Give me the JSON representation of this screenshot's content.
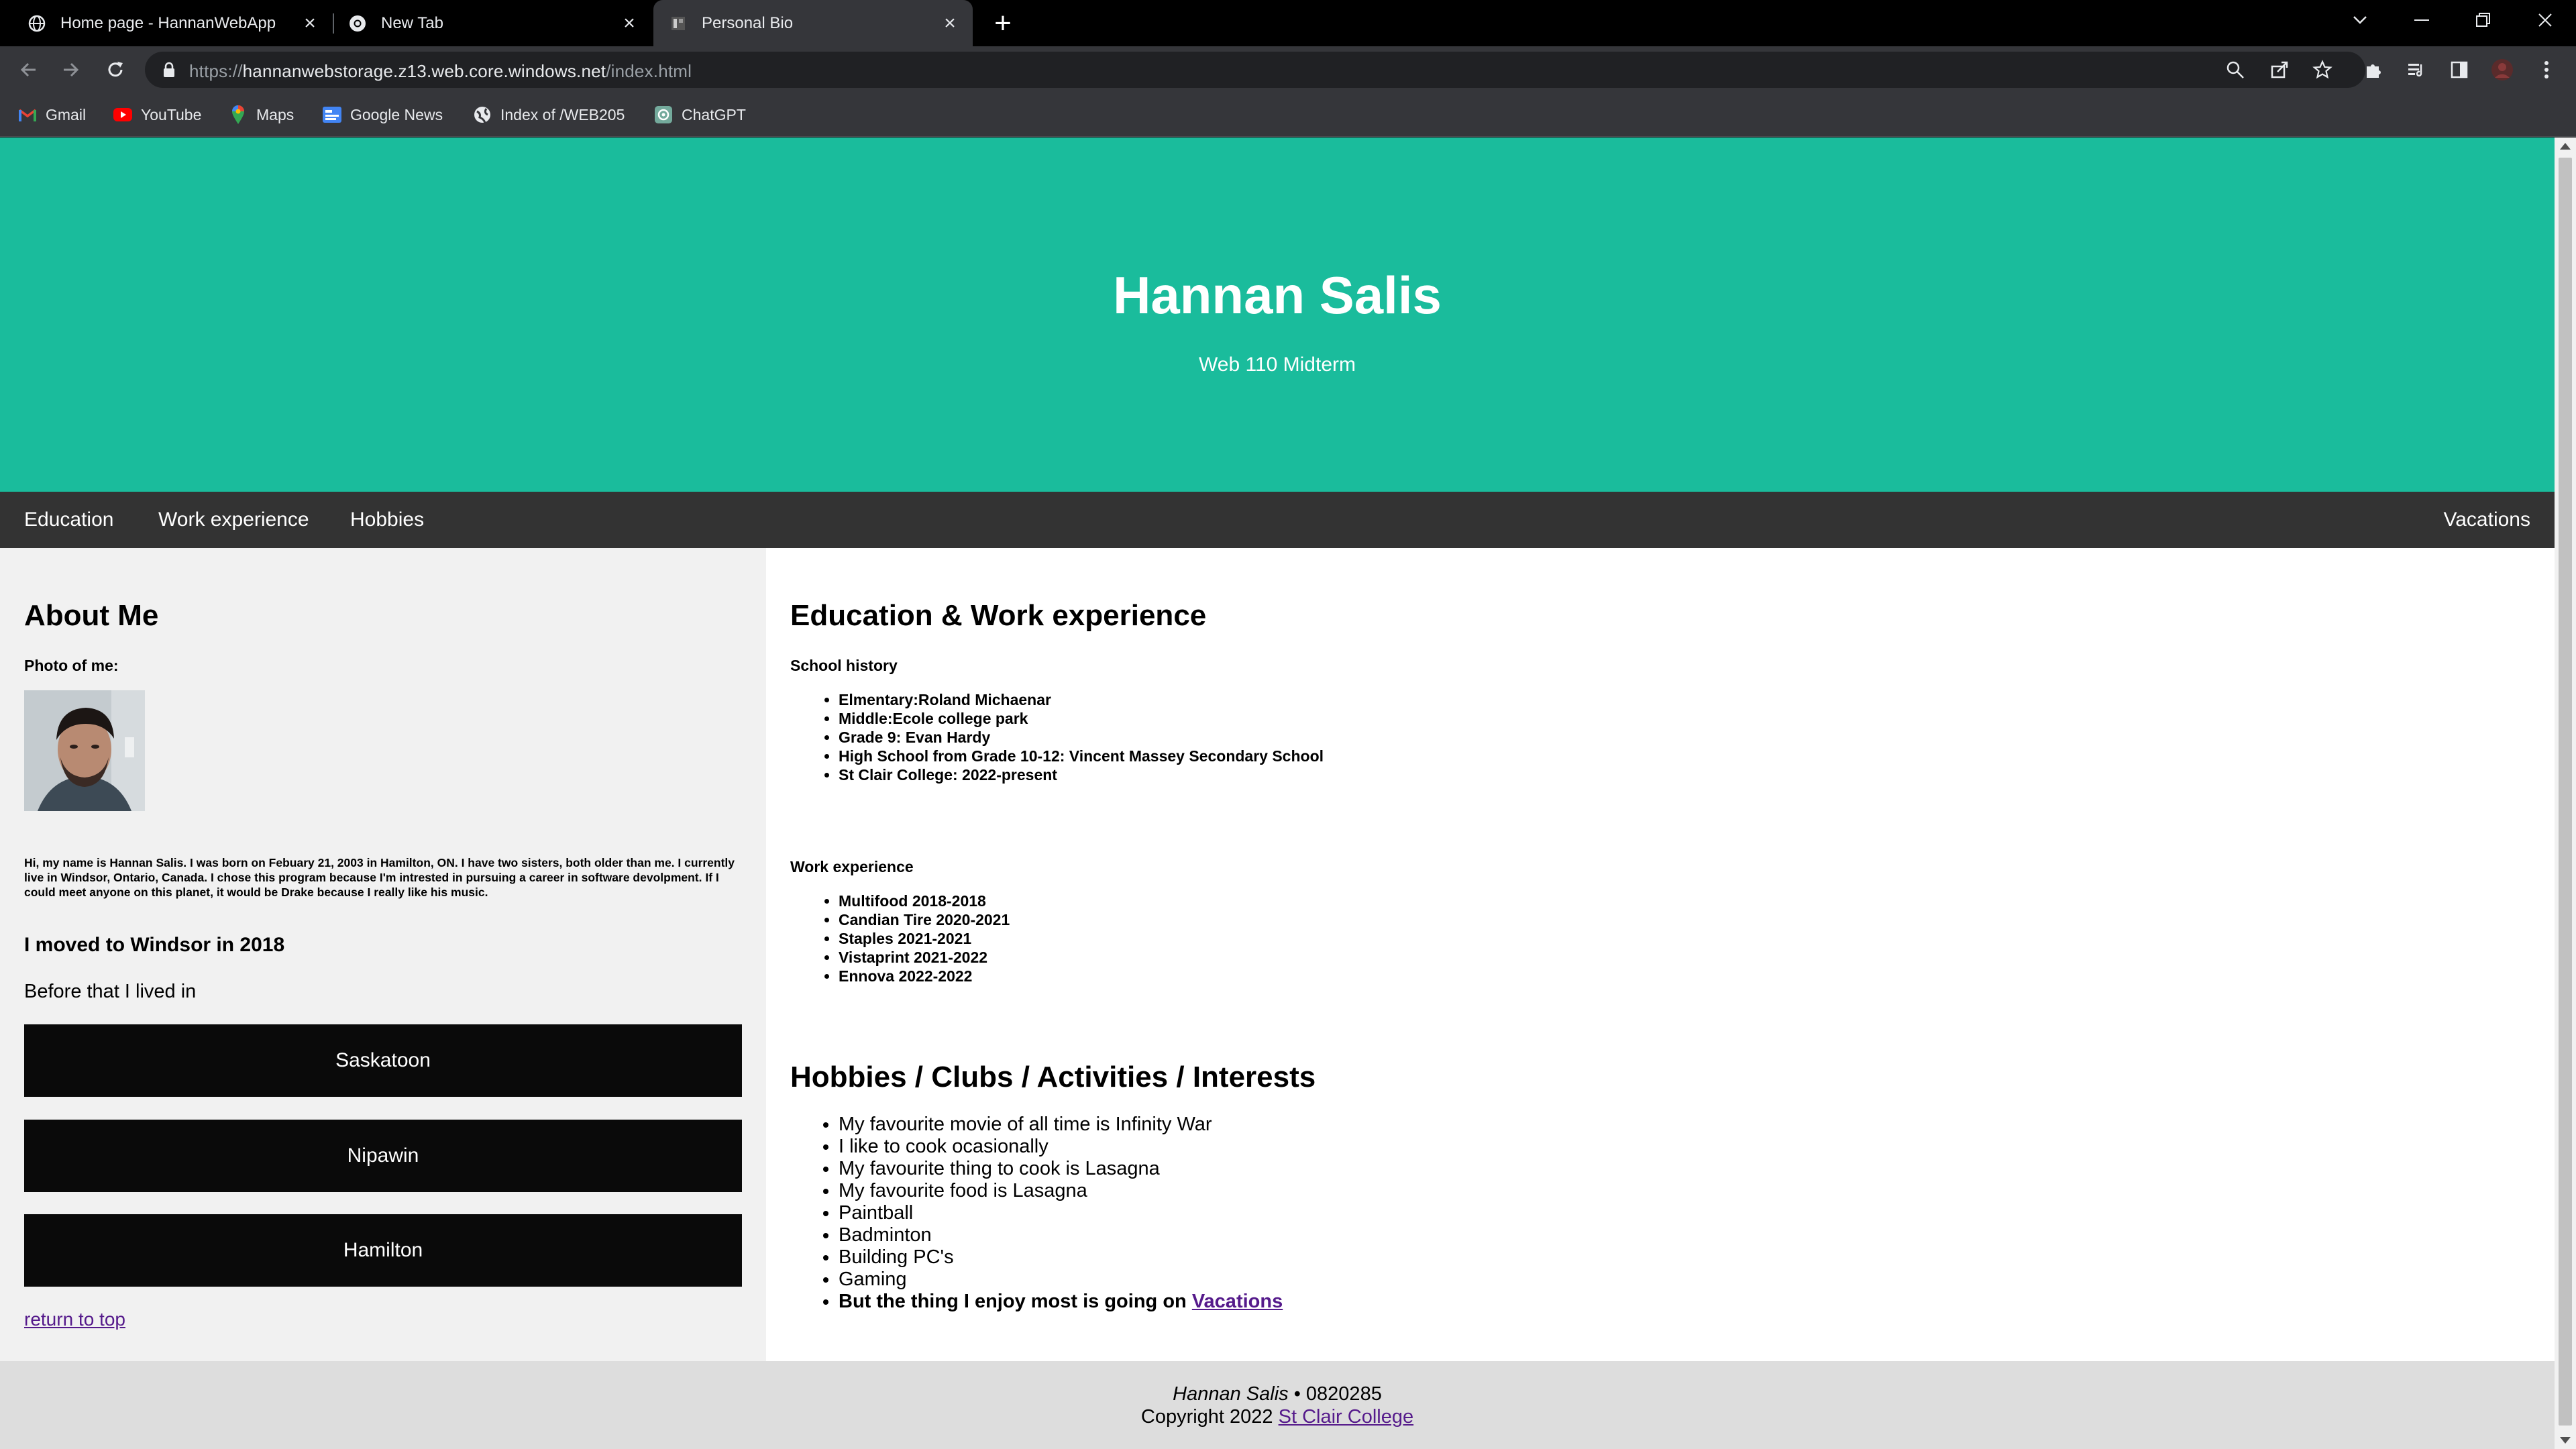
{
  "browser": {
    "tabs": [
      {
        "title": "Home page - HannanWebApp",
        "icon": "globe-icon",
        "active": false
      },
      {
        "title": "New Tab",
        "icon": "chrome-icon",
        "active": false
      },
      {
        "title": "Personal Bio",
        "icon": "page-icon",
        "active": true
      }
    ],
    "url": {
      "prefix": "https://",
      "host": "hannanwebstorage.z13.web.core.windows.net",
      "path": "/index.html"
    },
    "bookmarks": [
      {
        "label": "Gmail",
        "icon": "gmail-icon"
      },
      {
        "label": "YouTube",
        "icon": "youtube-icon"
      },
      {
        "label": "Maps",
        "icon": "maps-icon"
      },
      {
        "label": "Google News",
        "icon": "news-icon"
      },
      {
        "label": "Index of /WEB205",
        "icon": "globe-icon"
      },
      {
        "label": "ChatGPT",
        "icon": "chatgpt-icon"
      }
    ]
  },
  "header": {
    "title": "Hannan Salis",
    "subtitle": "Web 110 Midterm"
  },
  "nav": {
    "education": "Education",
    "work": "Work experience",
    "hobbies": "Hobbies",
    "vacations": "Vacations"
  },
  "about": {
    "heading": "About Me",
    "photo_label": "Photo of me:",
    "bio": "Hi, my name is Hannan Salis. I was born on Febuary 21, 2003 in Hamilton, ON. I have two sisters, both older than me. I currently live in Windsor, Ontario, Canada. I chose this program because I'm intrested in pursuing a career in software devolpment. If I could meet anyone on this planet, it would be Drake because I really like his music.",
    "moved": "I moved to Windsor in 2018",
    "before": "Before that I lived in",
    "cities": [
      "Saskatoon",
      "Nipawin",
      "Hamilton"
    ],
    "return_link": "return to top"
  },
  "education_work": {
    "heading": "Education & Work experience",
    "school_heading": "School history",
    "schools": [
      "Elmentary:Roland Michaenar",
      "Middle:Ecole college park",
      "Grade 9: Evan Hardy",
      "High School from Grade 10-12: Vincent Massey Secondary School",
      "St Clair College: 2022-present"
    ],
    "work_heading": "Work experience",
    "jobs": [
      "Multifood 2018-2018",
      "Candian Tire 2020-2021",
      "Staples 2021-2021",
      "Vistaprint 2021-2022",
      "Ennova 2022-2022"
    ]
  },
  "hobbies": {
    "heading": "Hobbies / Clubs / Activities / Interests",
    "items": [
      "My favourite movie of all time is Infinity War",
      "I like to cook ocasionally",
      "My favourite thing to cook is Lasagna",
      "My favourite food is Lasagna",
      "Paintball",
      "Badminton",
      "Building PC's",
      "Gaming"
    ],
    "last_prefix": "But the thing I enjoy most is going on",
    "last_link": "Vacations"
  },
  "footer": {
    "name": "Hannan Salis",
    "id_text": " • 0820285",
    "copyright": "Copyright 2022 ",
    "college_link": "St Clair College"
  },
  "colors": {
    "header_bg": "#1abc9c",
    "nav_bg": "#333333",
    "sidebar_bg": "#f1f1f1",
    "footer_bg": "#dddddd",
    "link": "#551a8b"
  }
}
